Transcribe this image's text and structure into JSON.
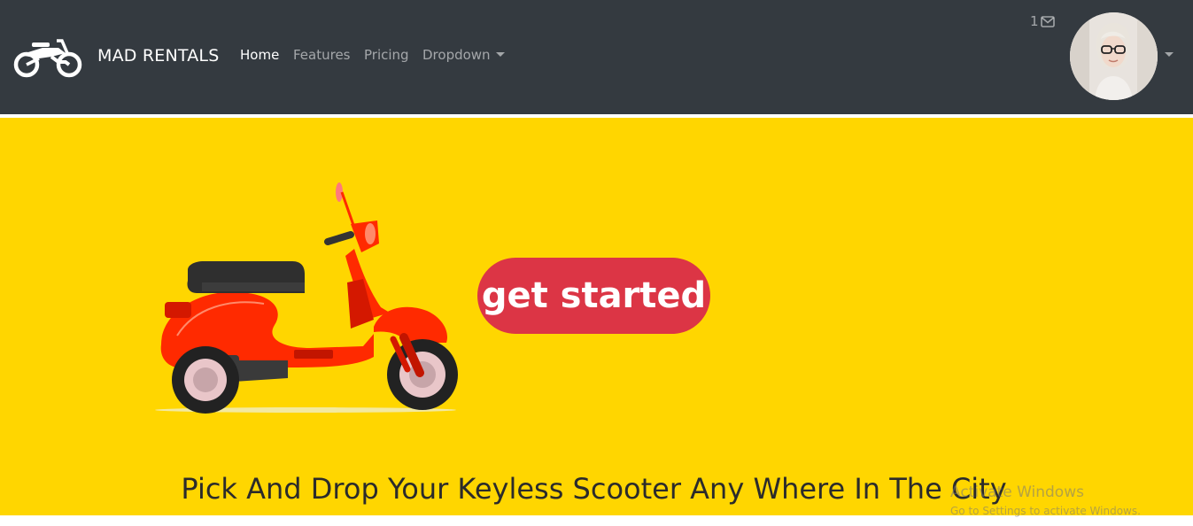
{
  "navbar": {
    "brand_icon": "motorcycle-icon",
    "brand": "MAD RENTALS",
    "links": [
      {
        "label": "Home",
        "active": true
      },
      {
        "label": "Features",
        "active": false
      },
      {
        "label": "Pricing",
        "active": false
      },
      {
        "label": "Dropdown",
        "active": false,
        "has_caret": true
      }
    ],
    "messages": {
      "count": "1",
      "icon": "envelope-icon"
    },
    "avatar_icon": "user-avatar",
    "avatar_caret_icon": "caret-down-icon"
  },
  "hero": {
    "image": "red-scooter-illustration",
    "cta_label": "get started",
    "tagline": "Pick And Drop Your Keyless Scooter Any Where In The City"
  },
  "watermark": {
    "title": "Activate Windows",
    "subtitle": "Go to Settings to activate Windows."
  },
  "colors": {
    "navbar_bg": "#343a40",
    "hero_bg": "#ffd600",
    "cta_bg": "#dc3545",
    "scooter_body": "#ff2a00"
  }
}
